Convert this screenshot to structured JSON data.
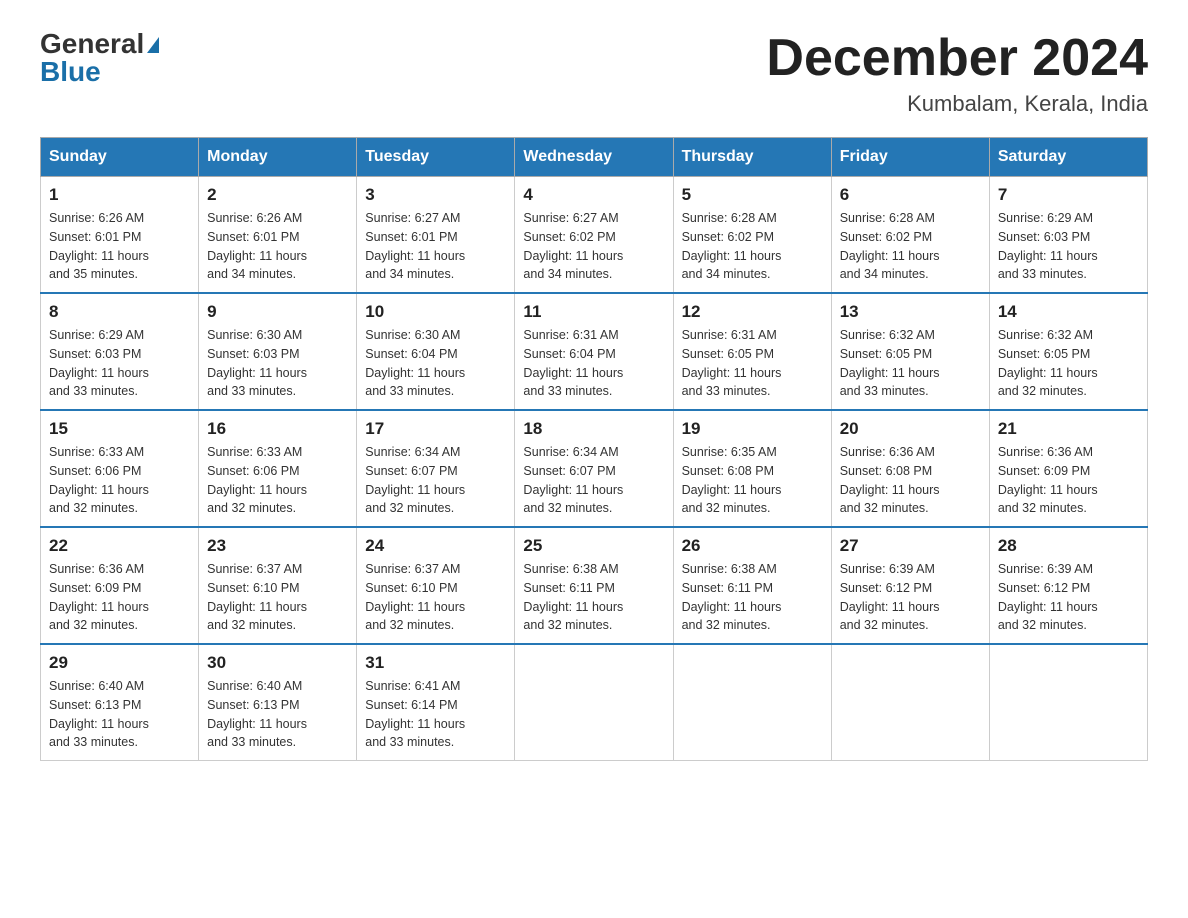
{
  "header": {
    "logo_general": "General",
    "logo_blue": "Blue",
    "month_title": "December 2024",
    "location": "Kumbalam, Kerala, India"
  },
  "days_of_week": [
    "Sunday",
    "Monday",
    "Tuesday",
    "Wednesday",
    "Thursday",
    "Friday",
    "Saturday"
  ],
  "weeks": [
    [
      {
        "day": "1",
        "sunrise": "6:26 AM",
        "sunset": "6:01 PM",
        "daylight": "11 hours and 35 minutes."
      },
      {
        "day": "2",
        "sunrise": "6:26 AM",
        "sunset": "6:01 PM",
        "daylight": "11 hours and 34 minutes."
      },
      {
        "day": "3",
        "sunrise": "6:27 AM",
        "sunset": "6:01 PM",
        "daylight": "11 hours and 34 minutes."
      },
      {
        "day": "4",
        "sunrise": "6:27 AM",
        "sunset": "6:02 PM",
        "daylight": "11 hours and 34 minutes."
      },
      {
        "day": "5",
        "sunrise": "6:28 AM",
        "sunset": "6:02 PM",
        "daylight": "11 hours and 34 minutes."
      },
      {
        "day": "6",
        "sunrise": "6:28 AM",
        "sunset": "6:02 PM",
        "daylight": "11 hours and 34 minutes."
      },
      {
        "day": "7",
        "sunrise": "6:29 AM",
        "sunset": "6:03 PM",
        "daylight": "11 hours and 33 minutes."
      }
    ],
    [
      {
        "day": "8",
        "sunrise": "6:29 AM",
        "sunset": "6:03 PM",
        "daylight": "11 hours and 33 minutes."
      },
      {
        "day": "9",
        "sunrise": "6:30 AM",
        "sunset": "6:03 PM",
        "daylight": "11 hours and 33 minutes."
      },
      {
        "day": "10",
        "sunrise": "6:30 AM",
        "sunset": "6:04 PM",
        "daylight": "11 hours and 33 minutes."
      },
      {
        "day": "11",
        "sunrise": "6:31 AM",
        "sunset": "6:04 PM",
        "daylight": "11 hours and 33 minutes."
      },
      {
        "day": "12",
        "sunrise": "6:31 AM",
        "sunset": "6:05 PM",
        "daylight": "11 hours and 33 minutes."
      },
      {
        "day": "13",
        "sunrise": "6:32 AM",
        "sunset": "6:05 PM",
        "daylight": "11 hours and 33 minutes."
      },
      {
        "day": "14",
        "sunrise": "6:32 AM",
        "sunset": "6:05 PM",
        "daylight": "11 hours and 32 minutes."
      }
    ],
    [
      {
        "day": "15",
        "sunrise": "6:33 AM",
        "sunset": "6:06 PM",
        "daylight": "11 hours and 32 minutes."
      },
      {
        "day": "16",
        "sunrise": "6:33 AM",
        "sunset": "6:06 PM",
        "daylight": "11 hours and 32 minutes."
      },
      {
        "day": "17",
        "sunrise": "6:34 AM",
        "sunset": "6:07 PM",
        "daylight": "11 hours and 32 minutes."
      },
      {
        "day": "18",
        "sunrise": "6:34 AM",
        "sunset": "6:07 PM",
        "daylight": "11 hours and 32 minutes."
      },
      {
        "day": "19",
        "sunrise": "6:35 AM",
        "sunset": "6:08 PM",
        "daylight": "11 hours and 32 minutes."
      },
      {
        "day": "20",
        "sunrise": "6:36 AM",
        "sunset": "6:08 PM",
        "daylight": "11 hours and 32 minutes."
      },
      {
        "day": "21",
        "sunrise": "6:36 AM",
        "sunset": "6:09 PM",
        "daylight": "11 hours and 32 minutes."
      }
    ],
    [
      {
        "day": "22",
        "sunrise": "6:36 AM",
        "sunset": "6:09 PM",
        "daylight": "11 hours and 32 minutes."
      },
      {
        "day": "23",
        "sunrise": "6:37 AM",
        "sunset": "6:10 PM",
        "daylight": "11 hours and 32 minutes."
      },
      {
        "day": "24",
        "sunrise": "6:37 AM",
        "sunset": "6:10 PM",
        "daylight": "11 hours and 32 minutes."
      },
      {
        "day": "25",
        "sunrise": "6:38 AM",
        "sunset": "6:11 PM",
        "daylight": "11 hours and 32 minutes."
      },
      {
        "day": "26",
        "sunrise": "6:38 AM",
        "sunset": "6:11 PM",
        "daylight": "11 hours and 32 minutes."
      },
      {
        "day": "27",
        "sunrise": "6:39 AM",
        "sunset": "6:12 PM",
        "daylight": "11 hours and 32 minutes."
      },
      {
        "day": "28",
        "sunrise": "6:39 AM",
        "sunset": "6:12 PM",
        "daylight": "11 hours and 32 minutes."
      }
    ],
    [
      {
        "day": "29",
        "sunrise": "6:40 AM",
        "sunset": "6:13 PM",
        "daylight": "11 hours and 33 minutes."
      },
      {
        "day": "30",
        "sunrise": "6:40 AM",
        "sunset": "6:13 PM",
        "daylight": "11 hours and 33 minutes."
      },
      {
        "day": "31",
        "sunrise": "6:41 AM",
        "sunset": "6:14 PM",
        "daylight": "11 hours and 33 minutes."
      },
      null,
      null,
      null,
      null
    ]
  ],
  "labels": {
    "sunrise": "Sunrise:",
    "sunset": "Sunset:",
    "daylight": "Daylight:"
  }
}
